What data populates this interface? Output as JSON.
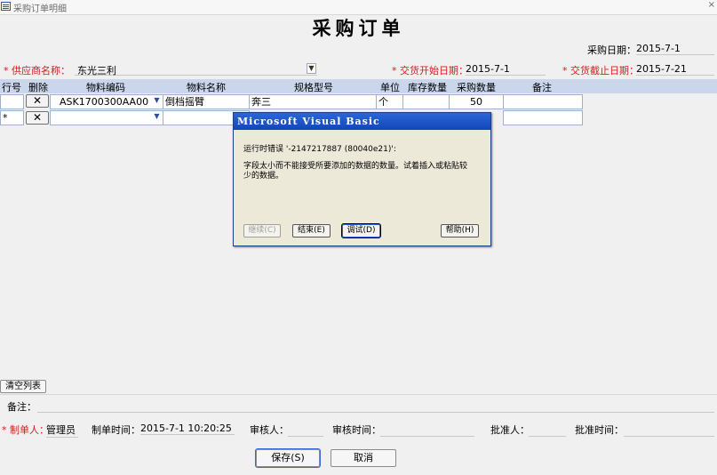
{
  "window": {
    "title": "采购订单明细"
  },
  "form": {
    "title": "采购订单",
    "purchase_date": {
      "label": "采购日期：",
      "value": "2015-7-1"
    },
    "supplier": {
      "label": "* 供应商名称：",
      "value": "东光三利"
    },
    "delivery_start": {
      "label": "* 交货开始日期：",
      "value": "2015-7-1"
    },
    "delivery_end": {
      "label": "* 交货截止日期：",
      "value": "2015-7-21"
    }
  },
  "grid": {
    "columns": [
      "行号",
      "删除",
      "物料编码",
      "物料名称",
      "规格型号",
      "单位",
      "库存数量",
      "采购数量",
      "备注"
    ],
    "rows": [
      {
        "row_no": "",
        "delete": "✕",
        "material_code": "ASK1700300AA00",
        "material_name": "倒档摇臂",
        "spec": "奔三",
        "unit": "个",
        "stock_qty": "",
        "purchase_qty": "50",
        "remark": ""
      },
      {
        "row_no": "*",
        "delete": "✕",
        "material_code": "",
        "material_name": "",
        "spec": "",
        "unit": "",
        "stock_qty": "",
        "purchase_qty": "",
        "remark": ""
      }
    ]
  },
  "dialog": {
    "title": "Microsoft Visual Basic",
    "error_line": "运行时错误 '-2147217887 (80040e21)':",
    "message_line1": "字段太小而不能接受所要添加的数据的数量。试着插入或粘贴较",
    "message_line2": "少的数据。",
    "buttons": {
      "continue": "继续(C)",
      "end": "结束(E)",
      "debug": "调试(D)",
      "help": "帮助(H)"
    }
  },
  "footer": {
    "clear_list": "清空列表",
    "remark_label": "备注：",
    "creator_label": "* 制单人：",
    "creator_value": "管理员",
    "created_time_label": "制单时间：",
    "created_time_value": "2015-7-1 10:20:25",
    "reviewer_label": "审核人：",
    "review_time_label": "审核时间：",
    "approver_label": "批准人：",
    "approve_time_label": "批准时间：",
    "save": "保存(S)",
    "cancel": "取消"
  }
}
